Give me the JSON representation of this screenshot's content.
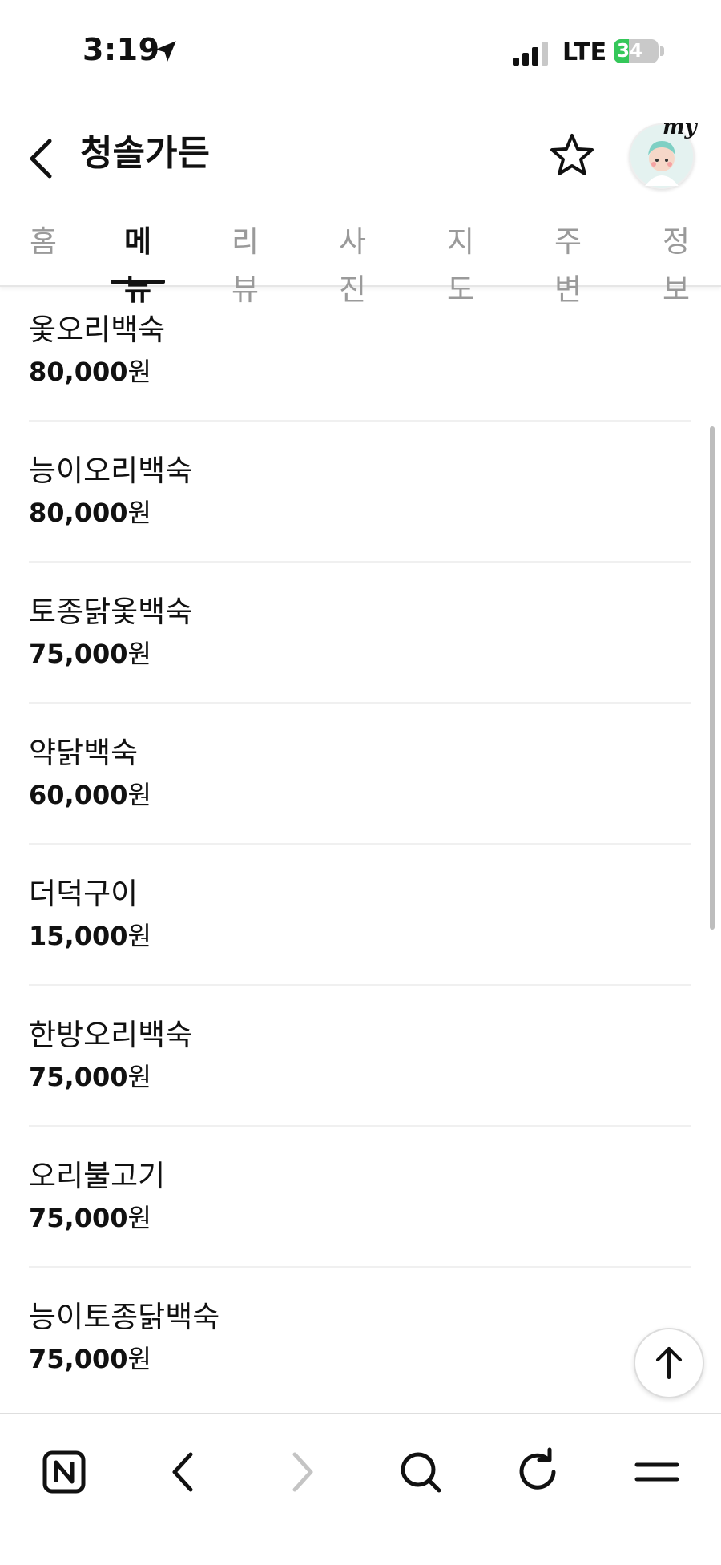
{
  "status_bar": {
    "time": "3:19",
    "network": "LTE",
    "battery": "34",
    "battery_level": 0.34
  },
  "header": {
    "title": "청솔가든",
    "avatar_badge": "my"
  },
  "tabs": [
    {
      "label": "홈",
      "active": false
    },
    {
      "label": "메뉴",
      "active": true
    },
    {
      "label": "리뷰",
      "active": false
    },
    {
      "label": "사진",
      "active": false
    },
    {
      "label": "지도",
      "active": false
    },
    {
      "label": "주변",
      "active": false
    },
    {
      "label": "정보",
      "active": false
    }
  ],
  "menu": {
    "items": [
      {
        "name": "옻오리백숙",
        "price": "80,000",
        "unit": "원"
      },
      {
        "name": "능이오리백숙",
        "price": "80,000",
        "unit": "원"
      },
      {
        "name": "토종닭옻백숙",
        "price": "75,000",
        "unit": "원"
      },
      {
        "name": "약닭백숙",
        "price": "60,000",
        "unit": "원"
      },
      {
        "name": "더덕구이",
        "price": "15,000",
        "unit": "원"
      },
      {
        "name": "한방오리백숙",
        "price": "75,000",
        "unit": "원"
      },
      {
        "name": "오리불고기",
        "price": "75,000",
        "unit": "원"
      },
      {
        "name": "능이토종닭백숙",
        "price": "75,000",
        "unit": "원"
      }
    ]
  },
  "colors": {
    "text": "#111111",
    "inactive_tab": "#9a9a9a",
    "battery_green": "#34c759",
    "divider": "#f0f0f0"
  },
  "icons": {
    "status": [
      "location-arrow-icon",
      "signal-bars-icon",
      "battery-icon"
    ],
    "header": [
      "back-chevron-icon",
      "star-icon",
      "avatar-icon"
    ],
    "toolbar": [
      "naver-n-icon",
      "back-icon",
      "forward-icon",
      "search-icon",
      "refresh-icon",
      "menu-icon"
    ]
  }
}
